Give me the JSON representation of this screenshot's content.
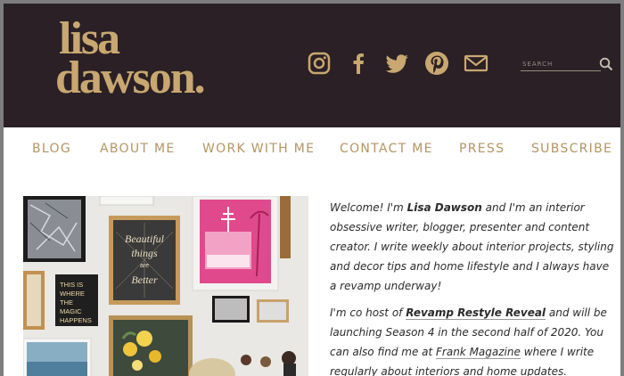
{
  "logo": {
    "line1": "lisa",
    "line2": "dawson."
  },
  "colors": {
    "header_bg": "#2a2025",
    "gold": "#c8a770",
    "nav_text": "#b59563"
  },
  "social": [
    {
      "name": "instagram-icon"
    },
    {
      "name": "facebook-icon"
    },
    {
      "name": "twitter-icon"
    },
    {
      "name": "pinterest-icon"
    },
    {
      "name": "email-icon"
    }
  ],
  "search": {
    "placeholder": "SEARCH",
    "icon": "search-icon"
  },
  "nav": {
    "items": [
      {
        "label": "BLOG"
      },
      {
        "label": "ABOUT ME"
      },
      {
        "label": "WORK WITH ME"
      },
      {
        "label": "CONTACT ME"
      },
      {
        "label": "PRESS"
      },
      {
        "label": "SUBSCRIBE"
      }
    ]
  },
  "photo": {
    "sign1": [
      "THIS IS",
      "WHERE",
      "THE",
      "MAGIC",
      "HAPPENS"
    ],
    "sign2": [
      "Beautiful",
      "things",
      "are",
      "Better"
    ]
  },
  "intro": {
    "p1_a": "Welcome!  I'm ",
    "p1_name": "Lisa Dawson",
    "p1_b": " and I'm an interior obsessive writer, blogger, presenter and content creator.  I write weekly about interior projects, styling and decor tips and home lifestyle and I always have a revamp underway!",
    "p2_a": "I'm co host of ",
    "p2_link1": "Revamp Restyle Reveal",
    "p2_b": " and will be launching Season 4 in the second half of 2020.  You can also find me at ",
    "p2_link2": "Frank Magazine",
    "p2_c": " where I write regularly about interiors and home updates."
  }
}
